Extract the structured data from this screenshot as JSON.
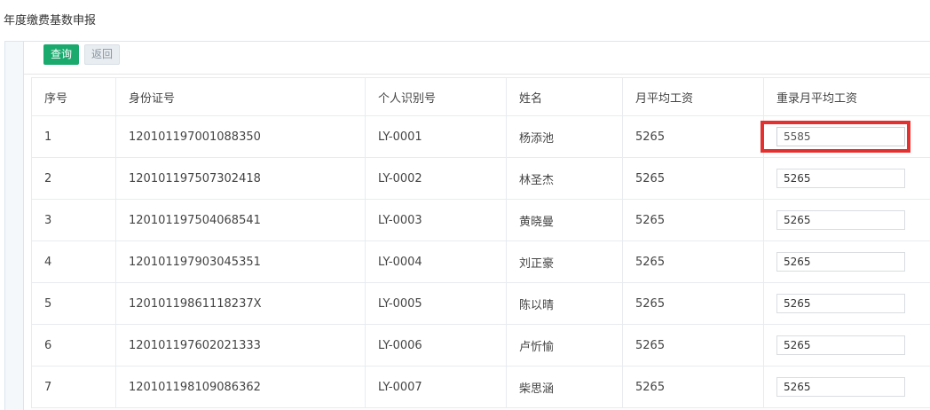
{
  "page": {
    "title": "年度缴费基数申报"
  },
  "toolbar": {
    "query_label": "查询",
    "back_label": "返回"
  },
  "table": {
    "headers": [
      "序号",
      "身份证号",
      "个人识别号",
      "姓名",
      "月平均工资",
      "重录月平均工资"
    ],
    "rows": [
      {
        "no": "1",
        "id_number": "120101197001088350",
        "personal_id": "LY-0001",
        "name": "杨添池",
        "wage": "5265",
        "re_wage": "5585"
      },
      {
        "no": "2",
        "id_number": "120101197507302418",
        "personal_id": "LY-0002",
        "name": "林圣杰",
        "wage": "5265",
        "re_wage": "5265"
      },
      {
        "no": "3",
        "id_number": "120101197504068541",
        "personal_id": "LY-0003",
        "name": "黄晓曼",
        "wage": "5265",
        "re_wage": "5265"
      },
      {
        "no": "4",
        "id_number": "120101197903045351",
        "personal_id": "LY-0004",
        "name": "刘正豪",
        "wage": "5265",
        "re_wage": "5265"
      },
      {
        "no": "5",
        "id_number": "12010119861118237X",
        "personal_id": "LY-0005",
        "name": "陈以晴",
        "wage": "5265",
        "re_wage": "5265"
      },
      {
        "no": "6",
        "id_number": "120101197602021333",
        "personal_id": "LY-0006",
        "name": "卢忻愉",
        "wage": "5265",
        "re_wage": "5265"
      },
      {
        "no": "7",
        "id_number": "120101198109086362",
        "personal_id": "LY-0007",
        "name": "柴思涵",
        "wage": "5265",
        "re_wage": "5265"
      }
    ]
  },
  "highlight": {
    "color": "#e53030",
    "row_index": 0
  }
}
